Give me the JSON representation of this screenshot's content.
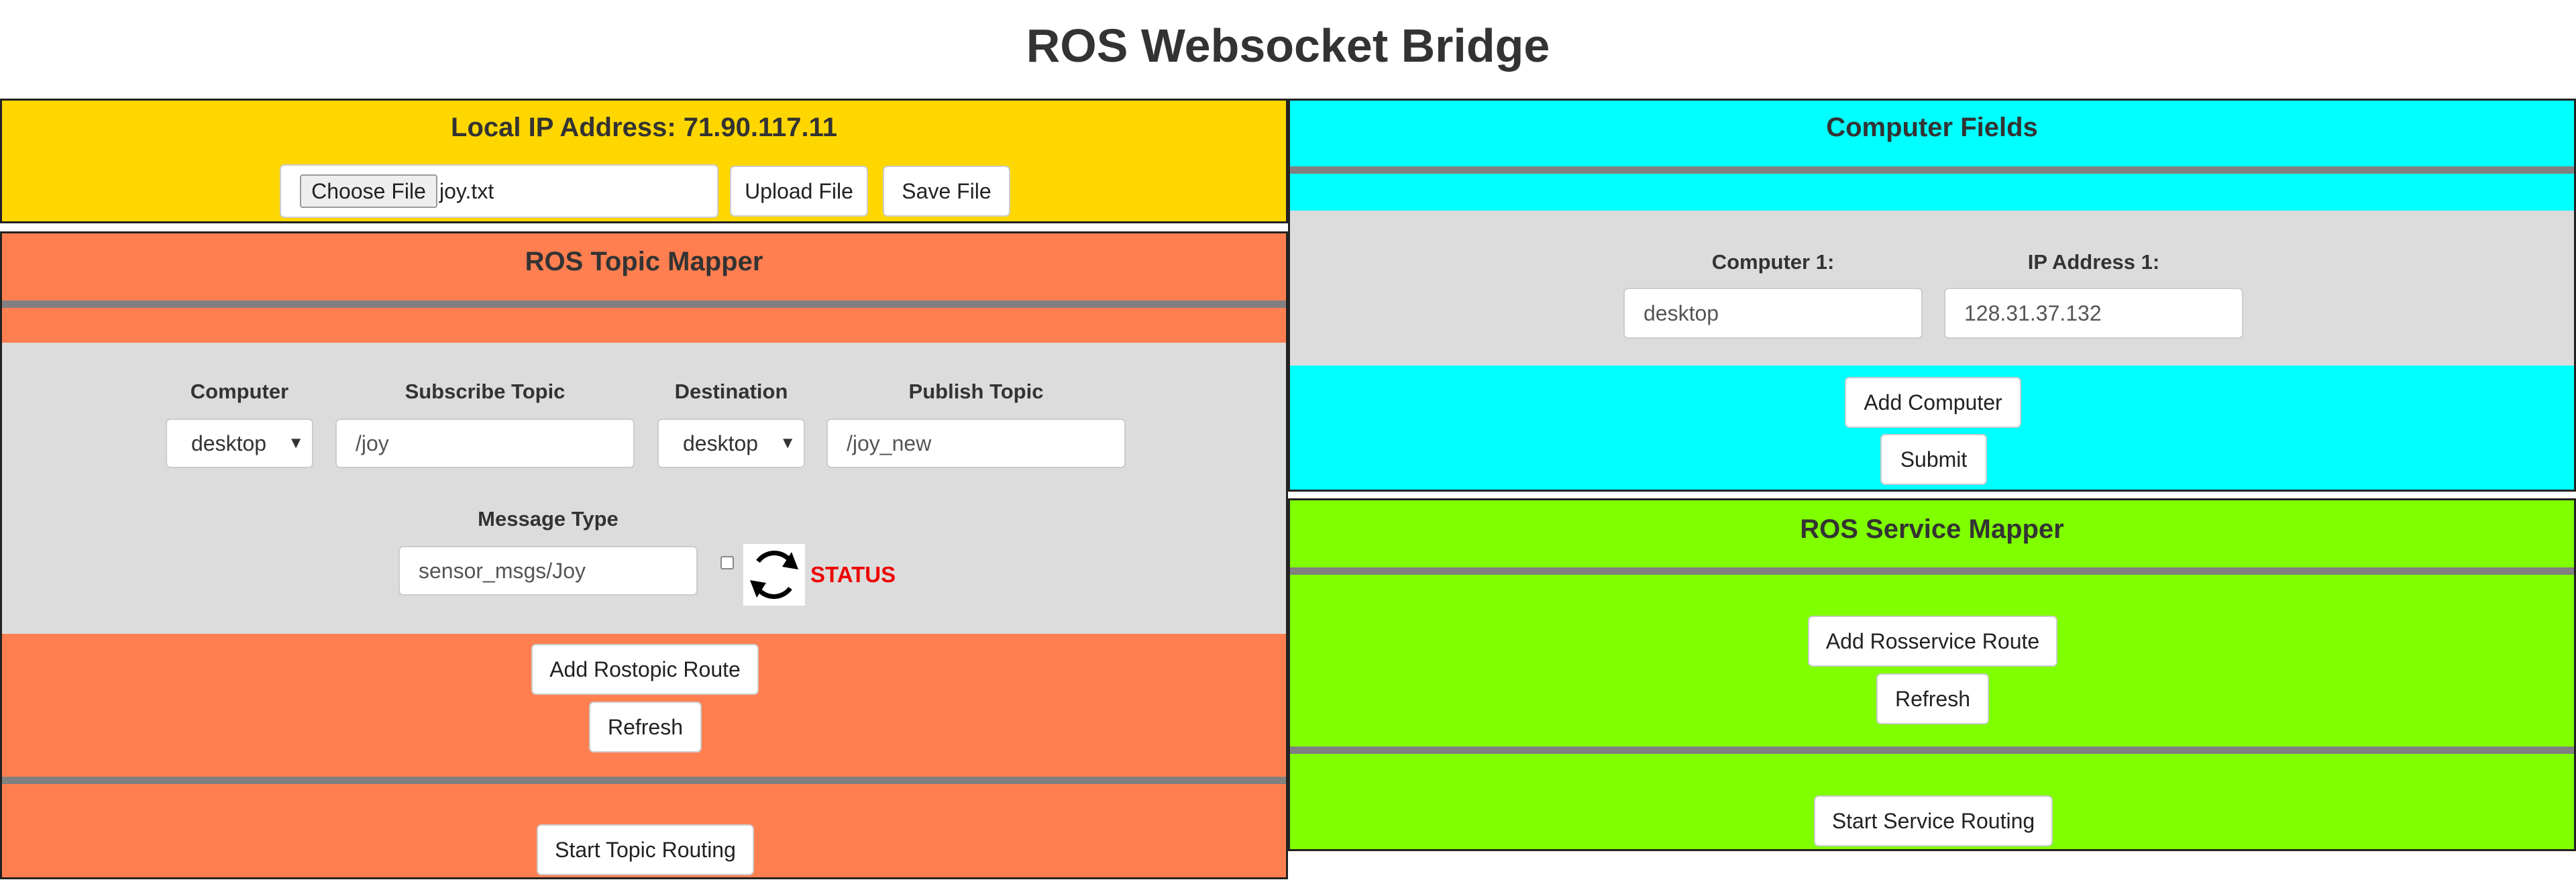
{
  "page": {
    "title": "ROS Websocket Bridge"
  },
  "ip_panel": {
    "title": "Local IP Address: 71.90.117.11",
    "choose_file_label": "Choose File",
    "file_name": "joy.txt",
    "upload_label": "Upload File",
    "save_label": "Save File",
    "bg_color": "#ffd700"
  },
  "topic_mapper": {
    "title": "ROS Topic Mapper",
    "bg_color": "#ff7f50",
    "labels": {
      "computer": "Computer",
      "subscribe": "Subscribe Topic",
      "destination": "Destination",
      "publish": "Publish Topic",
      "message_type": "Message Type"
    },
    "values": {
      "computer": "desktop",
      "subscribe": "/joy",
      "destination": "desktop",
      "publish": "/joy_new",
      "message_type": "sensor_msgs/Joy"
    },
    "status_label": "STATUS",
    "status_color": "#ee0000",
    "refresh_icon": "refresh-icon",
    "add_route_label": "Add Rostopic Route",
    "refresh_label": "Refresh",
    "start_label": "Start Topic Routing"
  },
  "computer_fields": {
    "title": "Computer Fields",
    "bg_color": "#00ffff",
    "computer_label": "Computer 1:",
    "ip_label": "IP Address 1:",
    "computer_value": "desktop",
    "ip_value": "128.31.37.132",
    "add_label": "Add Computer",
    "submit_label": "Submit"
  },
  "service_mapper": {
    "title": "ROS Service Mapper",
    "bg_color": "#7fff00",
    "add_route_label": "Add Rosservice Route",
    "refresh_label": "Refresh",
    "start_label": "Start Service Routing"
  }
}
